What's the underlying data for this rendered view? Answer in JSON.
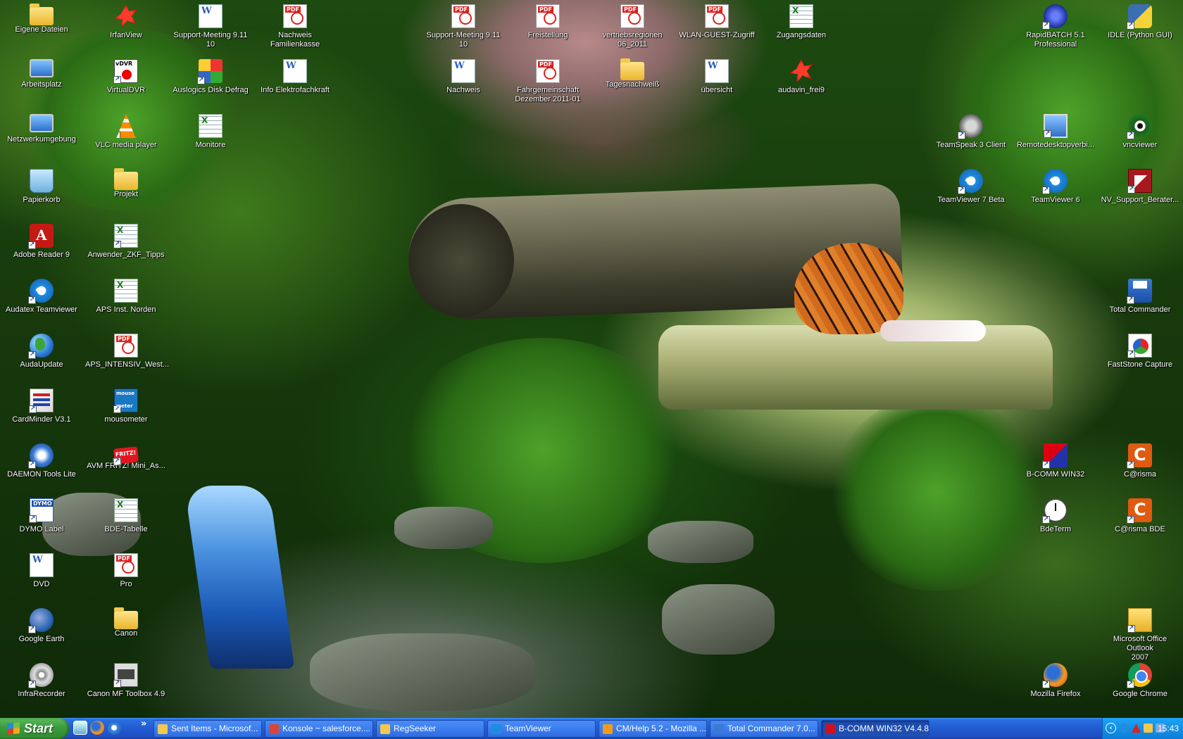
{
  "desktop": {
    "icons": [
      {
        "label": "Eigene Dateien",
        "icon": "folder-icon",
        "glyph": "g-folder",
        "shortcut": false
      },
      {
        "label": "Arbeitsplatz",
        "icon": "computer-icon",
        "glyph": "g-monitor",
        "shortcut": false
      },
      {
        "label": "Netzwerkumgebung",
        "icon": "network-icon",
        "glyph": "g-monitor",
        "shortcut": false
      },
      {
        "label": "Papierkorb",
        "icon": "recycle-bin-icon",
        "glyph": "g-recycle",
        "shortcut": false
      },
      {
        "label": "Adobe Reader 9",
        "icon": "adobe-reader-icon",
        "glyph": "g-reader",
        "shortcut": true
      },
      {
        "label": "Audatex Teamviewer",
        "icon": "teamviewer-icon",
        "glyph": "g-tv",
        "shortcut": true
      },
      {
        "label": "AudaUpdate",
        "icon": "globe-icon",
        "glyph": "g-globe",
        "shortcut": true
      },
      {
        "label": "CardMinder V3.1",
        "icon": "cardminder-icon",
        "glyph": "g-card",
        "shortcut": true
      },
      {
        "label": "DAEMON Tools Lite",
        "icon": "daemon-tools-icon",
        "glyph": "g-daemon",
        "shortcut": true
      },
      {
        "label": "DYMO Label",
        "icon": "dymo-icon",
        "glyph": "g-dymo",
        "shortcut": true
      },
      {
        "label": "DVD",
        "icon": "word-document-icon",
        "glyph": "g-doc",
        "shortcut": false
      },
      {
        "label": "Google Earth",
        "icon": "google-earth-icon",
        "glyph": "g-gearth",
        "shortcut": true
      },
      {
        "label": "InfraRecorder",
        "icon": "infrarecorder-icon",
        "glyph": "g-infra",
        "shortcut": true
      },
      {
        "label": "IrfanView",
        "icon": "irfanview-icon",
        "glyph": "g-red",
        "shortcut": true
      },
      {
        "label": "VirtualDVR",
        "icon": "virtualdvr-icon",
        "glyph": "g-dvr",
        "shortcut": true
      },
      {
        "label": "VLC media player",
        "icon": "vlc-icon",
        "glyph": "g-cone",
        "shortcut": true
      },
      {
        "label": "Projekt",
        "icon": "folder-icon",
        "glyph": "g-folder",
        "shortcut": false
      },
      {
        "label": "Anwender_ZKF_Tipps",
        "icon": "excel-document-icon",
        "glyph": "g-xls",
        "shortcut": true
      },
      {
        "label": "APS Inst. Norden",
        "icon": "excel-document-icon",
        "glyph": "g-xls",
        "shortcut": false
      },
      {
        "label": "APS_INTENSIV_West...",
        "icon": "pdf-document-icon",
        "glyph": "g-pdf",
        "shortcut": false
      },
      {
        "label": "mousometer",
        "icon": "mousometer-icon",
        "glyph": "g-mouse",
        "shortcut": true
      },
      {
        "label": "AVM FRITZ! Mini_As...",
        "icon": "fritz-icon",
        "glyph": "g-fritz",
        "shortcut": true
      },
      {
        "label": "BDE-Tabelle",
        "icon": "excel-document-icon",
        "glyph": "g-xls",
        "shortcut": false
      },
      {
        "label": "Pro",
        "icon": "pdf-document-icon",
        "glyph": "g-pdf",
        "shortcut": false
      },
      {
        "label": "Canon",
        "icon": "folder-icon",
        "glyph": "g-folder",
        "shortcut": false
      },
      {
        "label": "Canon MF Toolbox 4.9",
        "icon": "canon-toolbox-icon",
        "glyph": "g-canon",
        "shortcut": true
      },
      {
        "label": "Support-Meeting 9.11\n10",
        "icon": "word-document-icon",
        "glyph": "g-doc",
        "shortcut": false
      },
      {
        "label": "Auslogics Disk Defrag",
        "icon": "defrag-icon",
        "glyph": "g-defrag",
        "shortcut": true
      },
      {
        "label": "Monitore",
        "icon": "excel-document-icon",
        "glyph": "g-xls",
        "shortcut": false
      },
      {
        "label": "Nachweis Familienkasse",
        "icon": "pdf-document-icon",
        "glyph": "g-pdf",
        "shortcut": false
      },
      {
        "label": "Info Elektrofachkraft",
        "icon": "word-document-icon",
        "glyph": "g-doc",
        "shortcut": false
      },
      {
        "label": "Support-Meeting 9.11\n10",
        "icon": "pdf-document-icon",
        "glyph": "g-pdf",
        "shortcut": false
      },
      {
        "label": "Nachweis",
        "icon": "word-document-icon",
        "glyph": "g-doc",
        "shortcut": false
      },
      {
        "label": "Freistellung",
        "icon": "pdf-document-icon",
        "glyph": "g-pdf",
        "shortcut": false
      },
      {
        "label": "Fahrgemeinschaft\nDezember 2011-01",
        "icon": "pdf-document-icon",
        "glyph": "g-pdf",
        "shortcut": false
      },
      {
        "label": "vertriebsregionen\n06_2011",
        "icon": "pdf-document-icon",
        "glyph": "g-pdf",
        "shortcut": false
      },
      {
        "label": "Tagesnachweiß",
        "icon": "folder-icon",
        "glyph": "g-folder",
        "shortcut": false
      },
      {
        "label": "WLAN-GUEST-Zugriff",
        "icon": "pdf-document-icon",
        "glyph": "g-pdf",
        "shortcut": false
      },
      {
        "label": "übersicht",
        "icon": "text-document-icon",
        "glyph": "g-doc",
        "shortcut": false
      },
      {
        "label": "Zugangsdaten",
        "icon": "excel-document-icon",
        "glyph": "g-xls",
        "shortcut": false
      },
      {
        "label": "audavin_frei9",
        "icon": "irfanview-icon",
        "glyph": "g-red",
        "shortcut": false
      },
      {
        "label": "RapidBATCH 5.1\nProfessional",
        "icon": "rapidbatch-icon",
        "glyph": "g-rapid",
        "shortcut": true
      },
      {
        "label": "IDLE (Python GUI)",
        "icon": "python-icon",
        "glyph": "g-py",
        "shortcut": true
      },
      {
        "label": "TeamSpeak 3 Client",
        "icon": "teamspeak-icon",
        "glyph": "g-ts",
        "shortcut": true
      },
      {
        "label": "Remotedesktopverbi...",
        "icon": "remote-desktop-icon",
        "glyph": "g-rdp",
        "shortcut": true
      },
      {
        "label": "vncviewer",
        "icon": "vnc-eye-icon",
        "glyph": "g-eye",
        "shortcut": true
      },
      {
        "label": "TeamViewer 7 Beta",
        "icon": "teamviewer-icon",
        "glyph": "g-tv",
        "shortcut": true
      },
      {
        "label": "TeamViewer 6",
        "icon": "teamviewer-icon",
        "glyph": "g-tv",
        "shortcut": true
      },
      {
        "label": "NV_Support_Berater...",
        "icon": "nv-support-icon",
        "glyph": "g-nv",
        "shortcut": true
      },
      {
        "label": "Total Commander",
        "icon": "floppy-disk-icon",
        "glyph": "g-disk",
        "shortcut": true
      },
      {
        "label": "FastStone Capture",
        "icon": "faststone-icon",
        "glyph": "g-fs",
        "shortcut": true
      },
      {
        "label": "B-COMM WIN32",
        "icon": "bcomm-icon",
        "glyph": "g-bcomm",
        "shortcut": true
      },
      {
        "label": "C@risma",
        "icon": "carisma-icon",
        "glyph": "g-carisma",
        "shortcut": true
      },
      {
        "label": "BdeTerm",
        "icon": "clock-icon",
        "glyph": "g-clock",
        "shortcut": true
      },
      {
        "label": "C@risma BDE",
        "icon": "carisma-icon",
        "glyph": "g-carisma",
        "shortcut": true
      },
      {
        "label": "Microsoft Office Outlook\n2007",
        "icon": "outlook-icon",
        "glyph": "g-outlook",
        "shortcut": true
      },
      {
        "label": "Mozilla Firefox",
        "icon": "firefox-icon",
        "glyph": "g-firefox",
        "shortcut": true
      },
      {
        "label": "Google Chrome",
        "icon": "chrome-icon",
        "glyph": "g-chrome",
        "shortcut": true
      }
    ]
  },
  "taskbar": {
    "start_label": "Start",
    "quicklaunch_more": "»",
    "tasks": [
      {
        "label": "Sent Items - Microsof...",
        "icon": "outlook-icon",
        "color": "#f2c94c",
        "active": false
      },
      {
        "label": "Konsole ~ salesforce....",
        "icon": "chrome-icon",
        "color": "#db4437",
        "active": false
      },
      {
        "label": "RegSeeker",
        "icon": "folder-icon",
        "color": "#f2c94c",
        "active": false
      },
      {
        "label": "TeamViewer",
        "icon": "teamviewer-icon",
        "color": "#1f8ce0",
        "active": false
      },
      {
        "label": "CM/Help 5.2 - Mozilla ...",
        "icon": "firefox-icon",
        "color": "#f39a1c",
        "active": false
      },
      {
        "label": "Total Commander 7.0...",
        "icon": "floppy-disk-icon",
        "color": "#3a7ad6",
        "active": false
      },
      {
        "label": "B-COMM WIN32 V4.4.8",
        "icon": "bcomm-icon",
        "color": "#d01020",
        "active": true
      }
    ],
    "tray": {
      "chevron": "‹",
      "clock": "15:43"
    }
  }
}
